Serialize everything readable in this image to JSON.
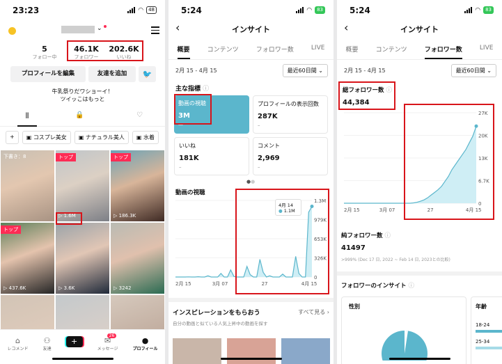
{
  "panel1": {
    "time": "23:23",
    "battery": "48",
    "stats": [
      {
        "value": "5",
        "label": "フォロー中"
      },
      {
        "value": "46.1K",
        "label": "フォロワー"
      },
      {
        "value": "202.6K",
        "label": "いいね"
      }
    ],
    "edit_profile": "プロフィールを編集",
    "add_friend": "友達を追加",
    "bio_line1": "牛乳祭りだワショーイ！",
    "bio_line2": "ツイッこはもっと",
    "playlists": [
      "コスプレ美女",
      "ナチュラル美人",
      "水着"
    ],
    "videos": [
      {
        "badge": "下書き：8",
        "views": ""
      },
      {
        "badge": "トップ",
        "views": "1.6M"
      },
      {
        "badge": "トップ",
        "views": "186.3K"
      },
      {
        "badge": "トップ",
        "views": "437.6K"
      },
      {
        "badge": "",
        "views": "3.6K"
      },
      {
        "badge": "",
        "views": "3242"
      },
      {
        "badge": "",
        "views": ""
      },
      {
        "badge": "",
        "views": ""
      },
      {
        "badge": "",
        "views": ""
      }
    ],
    "nav": [
      "レコメンド",
      "友達",
      "",
      "メッセージ",
      "プロフィール"
    ],
    "msg_count": "26"
  },
  "panel2": {
    "time": "5:24",
    "title": "インサイト",
    "tabs": [
      "概要",
      "コンテンツ",
      "フォロワー数",
      "LIVE"
    ],
    "date_range": "2月 15 - 4月 15",
    "date_select": "最近60日間",
    "section_title": "主な指標",
    "metrics": [
      {
        "label": "動画の視聴",
        "value": "3M",
        "delta": "—"
      },
      {
        "label": "プロフィールの表示回数",
        "value": "287K",
        "delta": "–"
      },
      {
        "label": "いいね",
        "value": "181K",
        "delta": "–"
      },
      {
        "label": "コメント",
        "value": "2,969",
        "delta": "–"
      }
    ],
    "chart_title": "動画の視聴",
    "tooltip_date": "4月 14",
    "tooltip_value": "1.1M",
    "inspiration_title": "インスピレーションをもらおう",
    "see_all": "すべて見る",
    "inspiration_desc": "自分の動画と似ている人気上昇中の動画を探す"
  },
  "panel3": {
    "time": "5:24",
    "title": "インサイト",
    "tabs": [
      "概要",
      "コンテンツ",
      "フォロワー数",
      "LIVE"
    ],
    "date_range": "2月 15 - 4月 15",
    "date_select": "最近60日間",
    "total_label": "総フォロワー数",
    "total_value": "44,384",
    "net_label": "純フォロワー数",
    "net_value": "41497",
    "net_compare": ">999% (Dec 17 日, 2022 ~ Feb 14 日, 2023との比較)",
    "insight_title": "フォロワーのインサイト",
    "gender": "性別",
    "age": "年齢",
    "age_groups": [
      "18-24",
      "25-34"
    ]
  },
  "chart_data": [
    {
      "type": "area",
      "title": "動画の視聴",
      "x": [
        "2月 15",
        "3月 07",
        "27",
        "4月 15"
      ],
      "yticks": [
        "1.3M",
        "979K",
        "653K",
        "326K",
        "0"
      ],
      "values": [
        0,
        0,
        0,
        0,
        2000,
        0,
        0,
        5000,
        0,
        0,
        20000,
        0,
        0,
        0,
        60000,
        0,
        0,
        120000,
        10000,
        0,
        0,
        0,
        180000,
        40000,
        0,
        0,
        300000,
        80000,
        0,
        20000,
        0,
        0,
        0,
        50000,
        0,
        0,
        0,
        350000,
        60000,
        0,
        0,
        1100000,
        1200000
      ],
      "ylim": [
        0,
        1300000
      ]
    },
    {
      "type": "area",
      "title": "総フォロワー数",
      "x": [
        "2月 15",
        "3月 07",
        "27",
        "4月 15"
      ],
      "yticks": [
        "27K",
        "20K",
        "13K",
        "6.7K",
        "0"
      ],
      "values": [
        0,
        0,
        0,
        0,
        0,
        0,
        0,
        0,
        0,
        0,
        0,
        0,
        0,
        0,
        0,
        0,
        0,
        0,
        0,
        0,
        100,
        300,
        600,
        1000,
        1600,
        2400,
        3200,
        4000,
        5000,
        6500,
        8000,
        10000,
        11500,
        13000,
        14500,
        16000,
        18000,
        20000,
        23000
      ],
      "ylim": [
        0,
        27000
      ]
    }
  ],
  "colors": {
    "accent": "#fe2c55",
    "teal": "#5bb6cc",
    "red_box": "#d8141a"
  }
}
